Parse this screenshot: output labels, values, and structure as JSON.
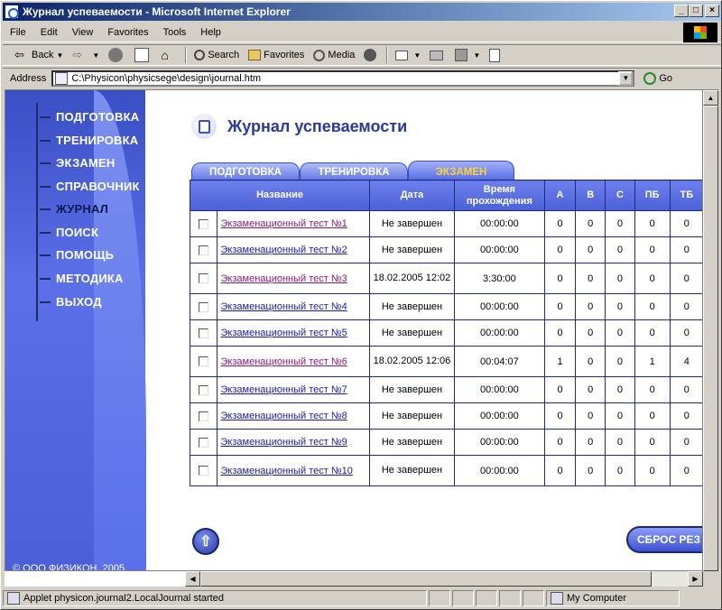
{
  "window": {
    "title": "Журнал успеваемости - Microsoft Internet Explorer"
  },
  "menu": [
    "File",
    "Edit",
    "View",
    "Favorites",
    "Tools",
    "Help"
  ],
  "toolbar": {
    "back": "Back",
    "search": "Search",
    "favorites": "Favorites",
    "media": "Media"
  },
  "address": {
    "label": "Address",
    "url": "C:\\Physicon\\physicsege\\design\\journal.htm",
    "go": "Go"
  },
  "sidebar": {
    "items": [
      "ПОДГОТОВКА",
      "ТРЕНИРОВКА",
      "ЭКЗАМЕН",
      "СПРАВОЧНИК",
      "ЖУРНАЛ",
      "ПОИСК",
      "ПОМОЩЬ",
      "МЕТОДИКА",
      "ВЫХОД"
    ],
    "active_index": 4,
    "copyright": "© ООО ФИЗИКОН, 2005"
  },
  "page": {
    "title": "Журнал успеваемости"
  },
  "tabs": [
    "ПОДГОТОВКА",
    "ТРЕНИРОВКА",
    "ЭКЗАМЕН"
  ],
  "table": {
    "headers": [
      "Название",
      "Дата",
      "Время прохождения",
      "А",
      "В",
      "С",
      "ПБ",
      "ТБ"
    ],
    "rows": [
      {
        "name": "Экзаменационный тест №1",
        "date": "Не завершен",
        "time": "00:00:00",
        "a": "0",
        "b": "0",
        "c": "0",
        "pb": "0",
        "tb": "0",
        "visited": true
      },
      {
        "name": "Экзаменационный тест №2",
        "date": "Не завершен",
        "time": "00:00:00",
        "a": "0",
        "b": "0",
        "c": "0",
        "pb": "0",
        "tb": "0",
        "visited": false
      },
      {
        "name": "Экзаменационный тест №3",
        "date": "18.02.2005 12:02",
        "time": "3:30:00",
        "a": "0",
        "b": "0",
        "c": "0",
        "pb": "0",
        "tb": "0",
        "visited": true
      },
      {
        "name": "Экзаменационный тест №4",
        "date": "Не завершен",
        "time": "00:00:00",
        "a": "0",
        "b": "0",
        "c": "0",
        "pb": "0",
        "tb": "0",
        "visited": false
      },
      {
        "name": "Экзаменационный тест №5",
        "date": "Не завершен",
        "time": "00:00:00",
        "a": "0",
        "b": "0",
        "c": "0",
        "pb": "0",
        "tb": "0",
        "visited": false
      },
      {
        "name": "Экзаменационный тест №6",
        "date": "18.02.2005 12:06",
        "time": "00:04:07",
        "a": "1",
        "b": "0",
        "c": "0",
        "pb": "1",
        "tb": "4",
        "visited": true
      },
      {
        "name": "Экзаменационный тест №7",
        "date": "Не завершен",
        "time": "00:00:00",
        "a": "0",
        "b": "0",
        "c": "0",
        "pb": "0",
        "tb": "0",
        "visited": false
      },
      {
        "name": "Экзаменационный тест №8",
        "date": "Не завершен",
        "time": "00:00:00",
        "a": "0",
        "b": "0",
        "c": "0",
        "pb": "0",
        "tb": "0",
        "visited": false
      },
      {
        "name": "Экзаменационный тест №9",
        "date": "Не завершен",
        "time": "00:00:00",
        "a": "0",
        "b": "0",
        "c": "0",
        "pb": "0",
        "tb": "0",
        "visited": false
      },
      {
        "name": "Экзаменационный тест №10",
        "date": "Не завершен",
        "time": "00:00:00",
        "a": "0",
        "b": "0",
        "c": "0",
        "pb": "0",
        "tb": "0",
        "visited": false
      }
    ]
  },
  "buttons": {
    "reset": "СБРОС РЕЗ"
  },
  "status": {
    "text": "Applet physicon.journal2.LocalJournal started",
    "zone": "My Computer"
  },
  "colors": {
    "accent": "#3a4fc4",
    "tab_active_text": "#ffd23a",
    "title_blue": "#2a3a9a"
  }
}
